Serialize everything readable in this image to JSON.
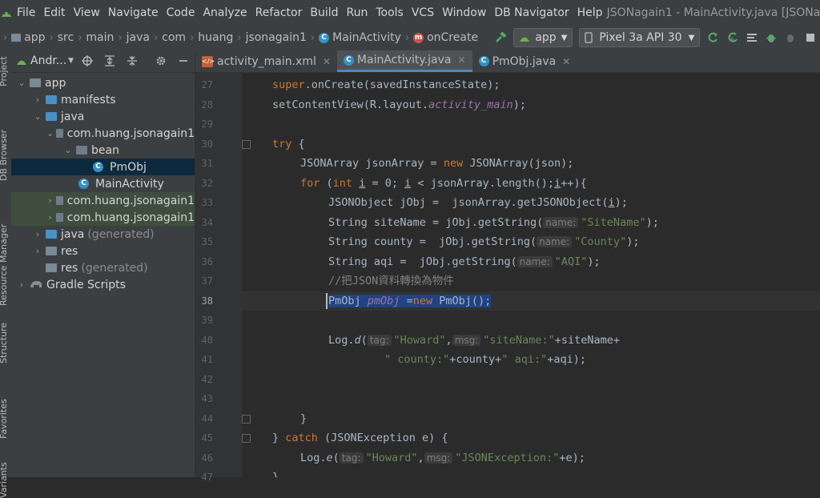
{
  "menubar": {
    "items": [
      "File",
      "Edit",
      "View",
      "Navigate",
      "Code",
      "Analyze",
      "Refactor",
      "Build",
      "Run",
      "Tools",
      "VCS",
      "Window",
      "DB Navigator",
      "Help"
    ],
    "window_title": "JSONagain1 - MainActivity.java [JSONag"
  },
  "navbar": {
    "breadcrumbs": [
      "app",
      "src",
      "main",
      "java",
      "com",
      "huang",
      "jsonagain1",
      "MainActivity",
      "onCreate"
    ],
    "run_config": "app",
    "device": "Pixel 3a API 30"
  },
  "side_labels": [
    "Project",
    "DB Browser",
    "Resource Manager",
    "Structure",
    "Favorites",
    "Variants"
  ],
  "project": {
    "title": "Andr...",
    "tree": [
      {
        "label": "app",
        "indent": 0,
        "arrow": "open",
        "icon": "folder"
      },
      {
        "label": "manifests",
        "indent": 1,
        "arrow": "closed",
        "icon": "folder-blue"
      },
      {
        "label": "java",
        "indent": 1,
        "arrow": "open",
        "icon": "folder-blue"
      },
      {
        "label": "com.huang.jsonagain1",
        "indent": 2,
        "arrow": "open",
        "icon": "package"
      },
      {
        "label": "bean",
        "indent": 3,
        "arrow": "open",
        "icon": "package"
      },
      {
        "label": "PmObj",
        "indent": 4,
        "arrow": "",
        "icon": "class",
        "selected": true
      },
      {
        "label": "MainActivity",
        "indent": 3,
        "arrow": "",
        "icon": "class"
      },
      {
        "label": "com.huang.jsonagain1",
        "indent": 2,
        "arrow": "closed",
        "icon": "package",
        "green": true
      },
      {
        "label": "com.huang.jsonagain1",
        "indent": 2,
        "arrow": "closed",
        "icon": "package",
        "green": true
      },
      {
        "label": "java",
        "suffix": "(generated)",
        "indent": 1,
        "arrow": "closed",
        "icon": "folder-gen"
      },
      {
        "label": "res",
        "indent": 1,
        "arrow": "closed",
        "icon": "folder"
      },
      {
        "label": "res",
        "suffix": "(generated)",
        "indent": 1,
        "arrow": "",
        "icon": "folder"
      },
      {
        "label": "Gradle Scripts",
        "indent": 0,
        "arrow": "closed",
        "icon": "gradle"
      }
    ]
  },
  "tabs": [
    {
      "label": "activity_main.xml",
      "icon": "xml"
    },
    {
      "label": "MainActivity.java",
      "icon": "class",
      "active": true
    },
    {
      "label": "PmObj.java",
      "icon": "class"
    }
  ],
  "code": {
    "line_numbers": [
      "27",
      "28",
      "29",
      "30",
      "31",
      "32",
      "33",
      "34",
      "35",
      "36",
      "37",
      "38",
      "39",
      "40",
      "41",
      "42",
      "43",
      "44",
      "45",
      "46",
      "47"
    ],
    "current_line": "38",
    "hint_name": "name:",
    "hint_tag": "tag:",
    "hint_msg": "msg:",
    "l27_a": "super",
    "l27_b": ".onCreate(savedInstanceState);",
    "l28_a": "setContentView(R.layout.",
    "l28_b": "activity_main",
    "l28_c": ");",
    "l30_kw": "try",
    "l30_b": " {",
    "l31_a": "JSONArray jsonArray = ",
    "l31_kw": "new",
    "l31_b": " JSONArray(json);",
    "l32_for": "for",
    "l32_a": " (",
    "l32_int": "int",
    "l32_b": " ",
    "l32_i1": "i",
    "l32_c": " = 0; ",
    "l32_i2": "i",
    "l32_d": " < jsonArray.length();",
    "l32_i3": "i",
    "l32_e": "++){",
    "l33_a": "JSONObject jObj =  jsonArray.getJSONObject(",
    "l33_i": "i",
    "l33_b": ");",
    "l34_a": "String siteName = jObj.getString(",
    "l34_s": "\"SiteName\"",
    "l34_b": ");",
    "l35_a": "String county =  jObj.getString(",
    "l35_s": "\"County\"",
    "l35_b": ");",
    "l36_a": "String aqi =  jObj.getString(",
    "l36_s": "\"AQI\"",
    "l36_b": ");",
    "l37_cm": "//把JSON資料轉換為物件",
    "l38_a": "PmObj ",
    "l38_v": "pmObj",
    "l38_b": " =",
    "l38_kw": "new",
    "l38_c": " PmObj();",
    "l40_a": "Log.",
    "l40_fn": "d",
    "l40_b": "(",
    "l40_s1": "\"Howard\"",
    "l40_c": ",",
    "l40_s2": "\"siteName:\"",
    "l40_d": "+siteName+",
    "l41_s1": "\" county:\"",
    "l41_a": "+county+",
    "l41_s2": "\" aqi:\"",
    "l41_b": "+aqi);",
    "l44_a": "}",
    "l45_a": "} ",
    "l45_kw": "catch",
    "l45_b": " (JSONException e) {",
    "l46_a": "Log.",
    "l46_fn": "e",
    "l46_b": "(",
    "l46_s1": "\"Howard\"",
    "l46_c": ",",
    "l46_s2": "\"JSONException:\"",
    "l46_d": "+e);",
    "l47_a": "}"
  },
  "colors": {
    "keyword": "#cc7832",
    "string": "#6a8759",
    "field": "#9876aa",
    "text": "#a9b7c6",
    "comment": "#808080",
    "selection": "#214283"
  }
}
